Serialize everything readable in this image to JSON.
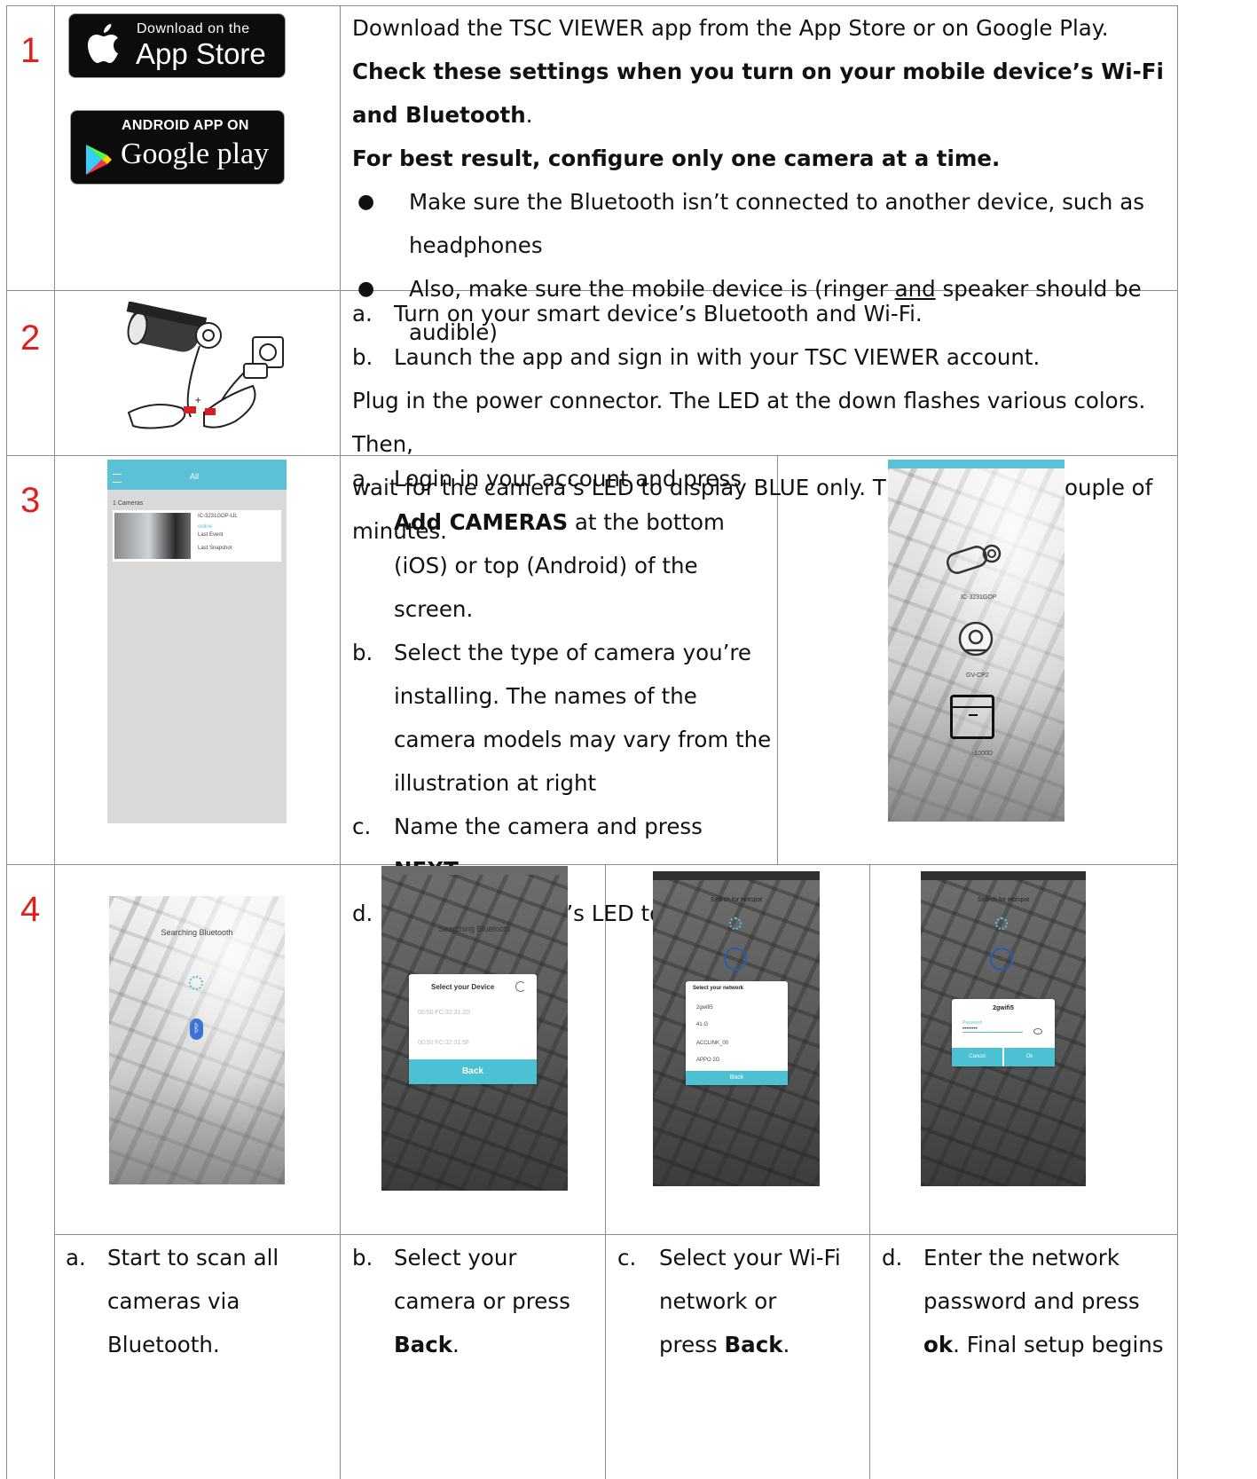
{
  "steps": [
    {
      "number": "1"
    },
    {
      "number": "2"
    },
    {
      "number": "3"
    },
    {
      "number": "4"
    }
  ],
  "colors": {
    "step_number": "#e0211b",
    "app_accent": "#5bc1d6",
    "grid": "#8c8c8c"
  },
  "step1": {
    "app_store": {
      "line1": "Download on the",
      "line2": "App Store"
    },
    "google_play": {
      "line1": "ANDROID APP ON",
      "line2": "Google play"
    },
    "line1": "Download the TSC VIEWER app from the App Store or on Google Play.",
    "line2_bold": "Check these settings when you turn on your mobile device’s Wi-Fi and Bluetooth",
    "line2_tail": ".",
    "line3": "For best result, configure only one camera at a time.",
    "bullet1": "Make sure the Bluetooth isn’t connected to another device, such as headphones",
    "bullet2_pre": "Also, make sure the mobile device is (ringer ",
    "bullet2_underlined": "and",
    "bullet2_post": " speaker should be audible)"
  },
  "step2": {
    "items": [
      {
        "label": "a.",
        "text": "Turn on your smart device’s Bluetooth and Wi-Fi."
      },
      {
        "label": "b.",
        "text": "Launch the app and sign in with your TSC VIEWER account."
      }
    ],
    "line3": "Plug in the power connector. The LED at the down flashes various colors. Then,",
    "line4": "wait for the camera’s LED to display BLUE only. This may take a couple of minutes."
  },
  "step3": {
    "items": [
      {
        "label": "a.",
        "pre": "Login in your account and press ",
        "bold": "Add CAMERAS",
        "post": " at the bottom (iOS) or top (Android) of the screen."
      },
      {
        "label": "b.",
        "text": "Select the type of camera you’re installing. The names of the camera models may vary from the illustration at right"
      },
      {
        "label": "c.",
        "pre": "Name the camera and press ",
        "bold": "NEXT."
      },
      {
        "label": "d.",
        "text": "and the camera’s LED to flash BLUE only"
      }
    ],
    "list_screen": {
      "filter": "All",
      "count": "1 Cameras",
      "camera_name": "IC-3231GOP-IJL",
      "status": "online",
      "last_event": "Last Event",
      "last_snapshot": "Last Snapshot"
    },
    "model_screen": {
      "models": [
        "IC-3231GOP",
        "GV-CP2",
        "-1000D"
      ]
    }
  },
  "step4": {
    "screens": [
      {
        "title": "Searching Bluetooth"
      },
      {
        "title": "Searching Bluetooth",
        "dialog_title": "Select your Device",
        "devices": [
          "00:50:FC:32:31:2D",
          "00:50:FC:32:31:5F"
        ],
        "back": "Back"
      },
      {
        "title": "Search for Hotspot",
        "dialog_title": "Select your network",
        "networks": [
          "2gwifi5",
          "41 G",
          "ACCLINK_00",
          "APPO 2G"
        ],
        "back": "Back"
      },
      {
        "title": "Search for Hotspot",
        "network": "2gwifi5",
        "password_label": "Password",
        "password_value": "••••••••",
        "cancel": "Cancel",
        "ok": "Ok"
      }
    ],
    "captions": [
      {
        "label": "a.",
        "text": "Start to scan all cameras via Bluetooth."
      },
      {
        "label": "b.",
        "pre": "Select your camera or press ",
        "bold": "Back",
        "post": "."
      },
      {
        "label": "c.",
        "pre": "Select your Wi-Fi network or press ",
        "bold": "Back",
        "post": "."
      },
      {
        "label": "d.",
        "pre": "Enter the network password and press ",
        "bold": "ok",
        "post": ". Final setup begins"
      }
    ]
  }
}
